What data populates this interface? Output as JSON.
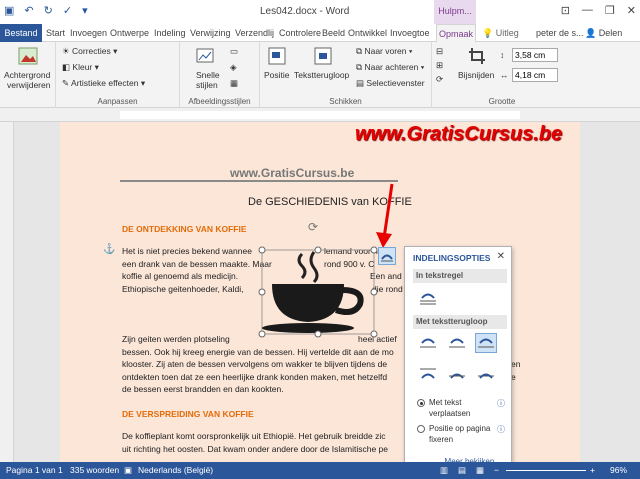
{
  "window": {
    "title": "Les042.docx - Word",
    "context_header": "Hulpm...",
    "minimize": "—",
    "restore": "❐",
    "close": "✕",
    "restore_ribbon": "⊡"
  },
  "tabs": [
    "Bestand",
    "Start",
    "Invoegen",
    "Ontwerpe",
    "Indeling",
    "Verwijzing",
    "Verzendlij",
    "Controlere",
    "Beeld",
    "Ontwikkel",
    "Invoegtoe",
    "Opmaak"
  ],
  "tell_me": "Uitleg",
  "user": "peter de s...",
  "share": "Delen",
  "ribbon": {
    "remove_bg": [
      "Achtergrond",
      "verwijderen"
    ],
    "corrections": "Correcties",
    "color": "Kleur",
    "artistic": "Artistieke effecten",
    "adjust_label": "Aanpassen",
    "quick_styles": [
      "Snelle",
      "stijlen"
    ],
    "styles_label": "Afbeeldingsstijlen",
    "position": "Positie",
    "wrap_text": "Tekstterugloop",
    "bring_forward": "Naar voren",
    "send_backward": "Naar achteren",
    "selection_pane": "Selectievenster",
    "arrange_label": "Schikken",
    "crop": "Bijsnijden",
    "height": "3,58 cm",
    "width": "4,18 cm",
    "size_label": "Grootte"
  },
  "document": {
    "site_banner": "www.GratisCursus.be",
    "watermark": "www.GratisCursus.be",
    "title": "De GESCHIEDENIS van KOFFIE",
    "heading1": "DE ONTDEKKING VAN KOFFIE",
    "para1": [
      "Het is niet precies bekend wannee",
      "een drank van de bessen maakte. Maar",
      "koffie al genoemd als medicijn.",
      "Ethiopische geitenhoeder, Kaldi,"
    ],
    "para1_right": [
      "lemand voor het",
      "rond 900 v. C",
      "Een and",
      "die rond"
    ],
    "para2": [
      "Zijn geiten werden plotseling",
      "bessen. Ook hij kreeg energie van de bessen. Hij vertelde dit aan de mo",
      "klooster. Zij aten de bessen vervolgens om wakker te blijven tijdens de",
      "ontdekten toen dat ze een heerlijke drank konden maken, met hetzelfd",
      "de bessen eerst brandden en dan kookten."
    ],
    "para2_right": "heel actief",
    "para3_right": [
      "en",
      "e"
    ],
    "heading2": "DE VERSPREIDING VAN KOFFIE",
    "para3": [
      "De koffieplant komt oorspronkelijk uit Ethiopië. Het gebruik breidde zic",
      "uit richting het oosten. Dat kwam onder andere door de Islamitische pe"
    ]
  },
  "layout_panel": {
    "title": "INDELINGSOPTIES",
    "inline_section": "In tekstregel",
    "wrap_section": "Met tekstterugloop",
    "option1": "Met tekst verplaatsen",
    "option2": "Positie op pagina fixeren",
    "more": "Meer bekijken..."
  },
  "status": {
    "page": "Pagina 1 van 1",
    "words": "335 woorden",
    "language": "Nederlands (België)",
    "zoom": "96%"
  },
  "colors": {
    "accent": "#2b579a",
    "picture_tools": "#7a3b8c",
    "heading": "#e36c09",
    "banner": "#e60000"
  }
}
